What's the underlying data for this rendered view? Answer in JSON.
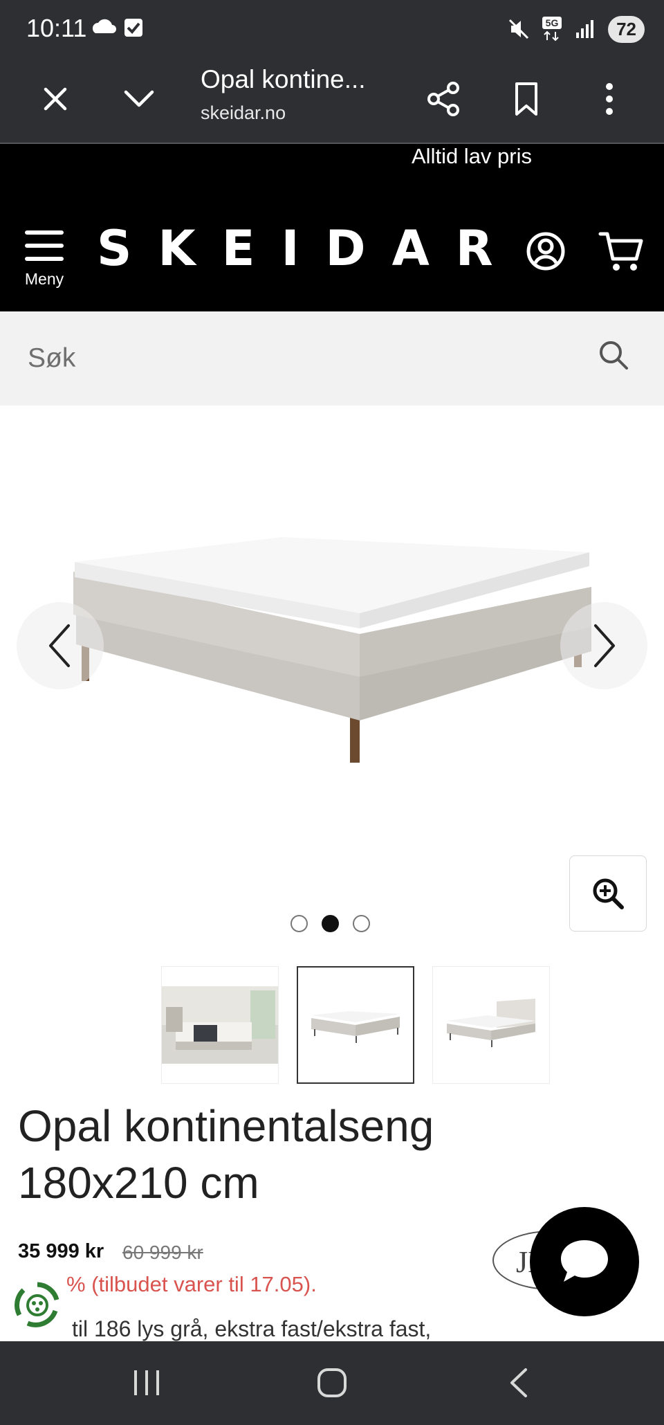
{
  "status_bar": {
    "time": "10:11",
    "battery": "72",
    "network": "5G",
    "icons": [
      "cloud-icon",
      "checkbox-icon",
      "mute-icon",
      "5g-icon",
      "signal-icon",
      "battery-icon"
    ]
  },
  "browser": {
    "title": "Opal kontine...",
    "url": "skeidar.no",
    "icons": [
      "close-icon",
      "chevron-down-icon",
      "share-icon",
      "bookmark-icon",
      "more-vert-icon"
    ]
  },
  "site": {
    "promo_text": "Alltid lav pris",
    "logo": "SKEIDAR",
    "menu_label": "Meny",
    "icons": [
      "hamburger-icon",
      "account-icon",
      "cart-icon"
    ]
  },
  "search": {
    "placeholder": "Søk",
    "icon": "search-icon"
  },
  "gallery": {
    "active_index": 1,
    "image_count": 3,
    "thumbnails": [
      "bedroom-photo",
      "continental-bed",
      "bed-with-headboard"
    ],
    "icons": [
      "chevron-left-icon",
      "chevron-right-icon",
      "zoom-in-icon"
    ]
  },
  "product": {
    "title_line1": "Opal kontinentalseng",
    "title_line2": "180x210 cm",
    "price": "35 999 kr",
    "old_price": "60 999 kr",
    "offer_text": "% (tilbudet varer til 17.05).",
    "description": "til 186 lys grå, ekstra fast/ekstra fast,",
    "brand_text": "JE",
    "offer_color": "#d9534f"
  },
  "colors": {
    "bar_dark": "#2e2f33",
    "header_black": "#000000",
    "search_bg": "#f2f2f2",
    "eco_green": "#2e7d32"
  },
  "system_nav": {
    "icons": [
      "recents-icon",
      "home-icon",
      "back-icon"
    ]
  }
}
